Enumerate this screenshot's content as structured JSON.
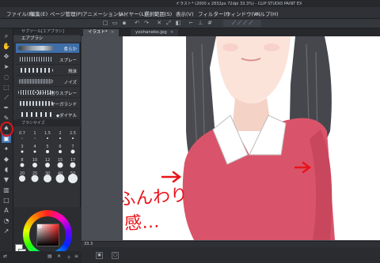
{
  "window": {
    "title": "イラスト* (2000 x 2832px 72dpi 33.3%)  - CLIP STUDIO PAINT EX"
  },
  "menu": [
    {
      "label": "ファイル(F)"
    },
    {
      "label": "編集(E)"
    },
    {
      "label": "ページ管理(P)"
    },
    {
      "label": "アニメーション(A)"
    },
    {
      "label": "レイヤー(L)"
    },
    {
      "label": "選択範囲(S)"
    },
    {
      "label": "表示(V)"
    },
    {
      "label": "フィルター(I)"
    },
    {
      "label": "ウィンドウ(W)"
    },
    {
      "label": "ヘルプ(H)"
    }
  ],
  "subtool_panel": {
    "header": "サブツール[エアブラシ]",
    "active_group": "エアブラシ",
    "brushes": [
      {
        "name": "柔らか",
        "selected": true
      },
      {
        "name": "スプレー",
        "selected": false
      },
      {
        "name": "飛沫",
        "selected": false
      },
      {
        "name": "ノイズ",
        "selected": false
      },
      {
        "name": "トーン削りスプレー",
        "selected": false
      },
      {
        "name": "マーガランド",
        "selected": false
      },
      {
        "name": "◆ダイヤル",
        "selected": false
      }
    ]
  },
  "brush_size_panel": {
    "header": "ブラシサイズ",
    "sizes": [
      "0.7",
      "1",
      "1.5",
      "2",
      "2.5",
      "3",
      "4",
      "5",
      "6",
      "7",
      "8",
      "10",
      "12",
      "15",
      "17",
      "20",
      "25",
      "30",
      "40",
      "50"
    ]
  },
  "tabs": [
    {
      "label": "イラスト*",
      "active": true
    },
    {
      "label": "yoshaneko.jpg",
      "active": false
    }
  ],
  "canvas": {
    "annotation_main": "ふんわり",
    "annotation_sub": "感…",
    "annotation_color": "#e8141a"
  },
  "status": {
    "zoom": "33.3"
  },
  "colors": {
    "accent_selected": "#3f6ea8",
    "highlight_ring": "#e0161a",
    "sweater": "#d9546a",
    "main_color": "#ffffff"
  }
}
